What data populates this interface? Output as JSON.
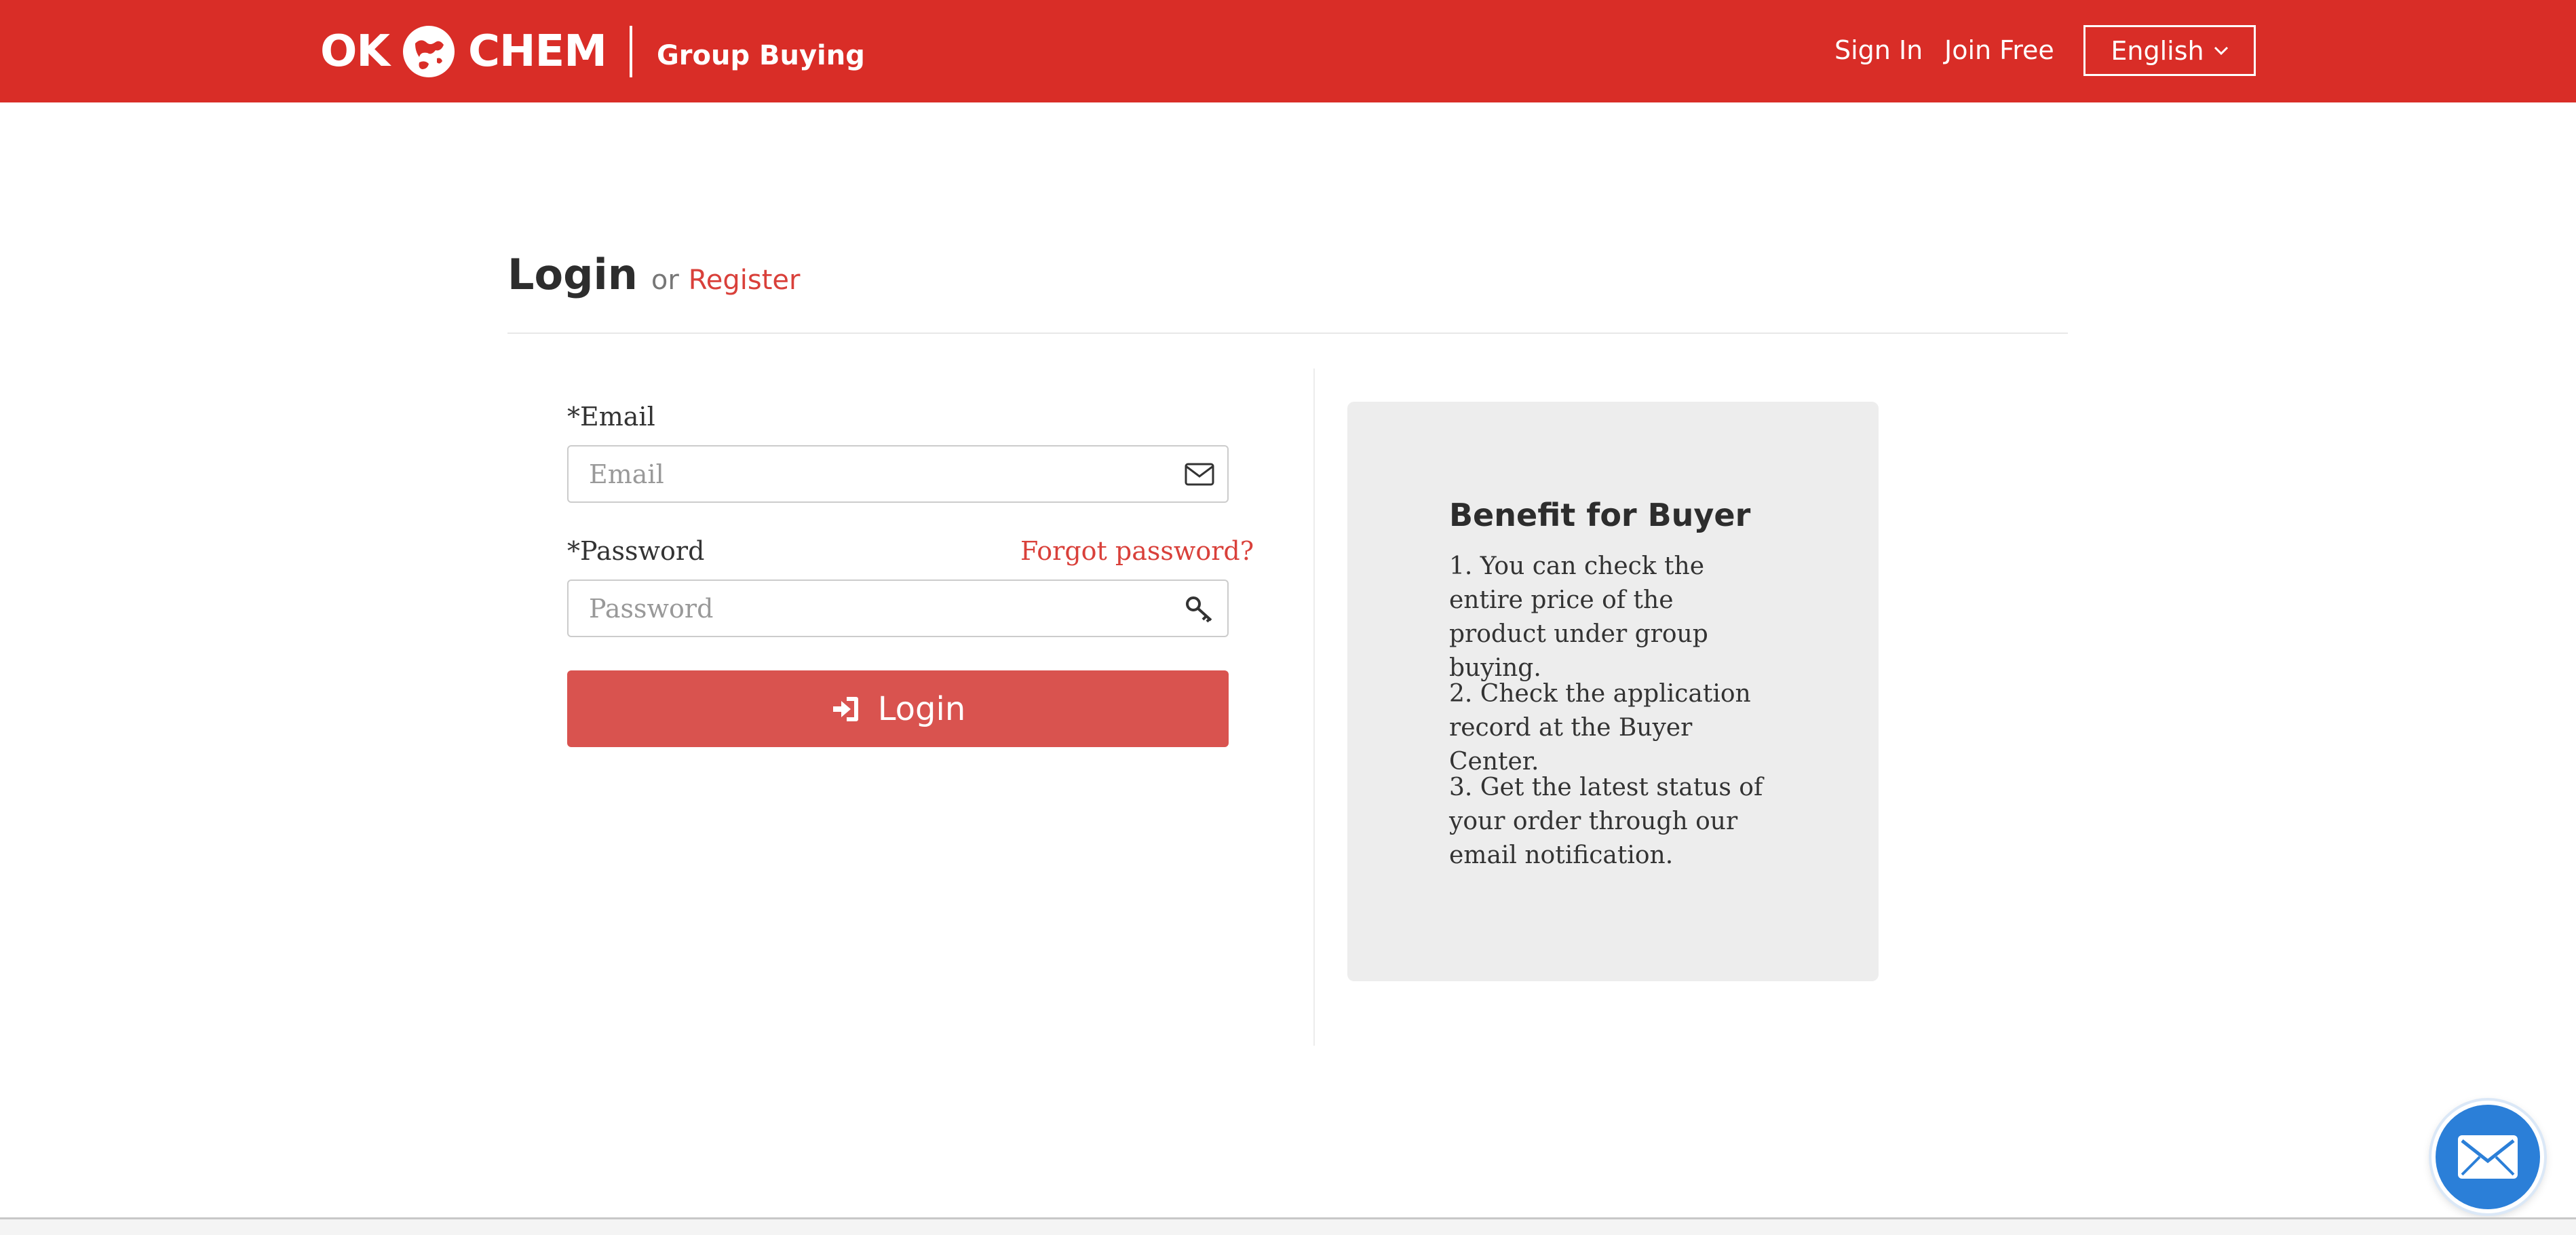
{
  "header": {
    "logo_left": "OK",
    "logo_right": "CHEM",
    "logo_sub": "Group Buying",
    "nav": {
      "sign_in": "Sign In",
      "join_free": "Join Free"
    },
    "language": "English"
  },
  "page": {
    "title": "Login",
    "or_text": "or",
    "register_link": "Register"
  },
  "form": {
    "email_label": "*Email",
    "email_placeholder": "Email",
    "password_label": "*Password",
    "forgot_link": "Forgot password?",
    "password_placeholder": "Password",
    "login_button": "Login"
  },
  "benefits": {
    "title": "Benefit for Buyer",
    "items": [
      "1. You can check the entire price of the product under group buying.",
      "2. Check the application record at the Buyer Center.",
      "3. Get the latest status of your order through our email notification."
    ]
  },
  "icons": {
    "email_field": "envelope-icon",
    "password_field": "key-icon",
    "login_button": "sign-in-icon",
    "language_dropdown": "chevron-down-icon",
    "floating_contact": "mail-icon"
  },
  "colors": {
    "brand_red": "#d92d27",
    "button_red": "#d9534f",
    "link_red": "#d9403a",
    "panel_gray": "#ededed",
    "fab_blue": "#2b7fd8"
  }
}
